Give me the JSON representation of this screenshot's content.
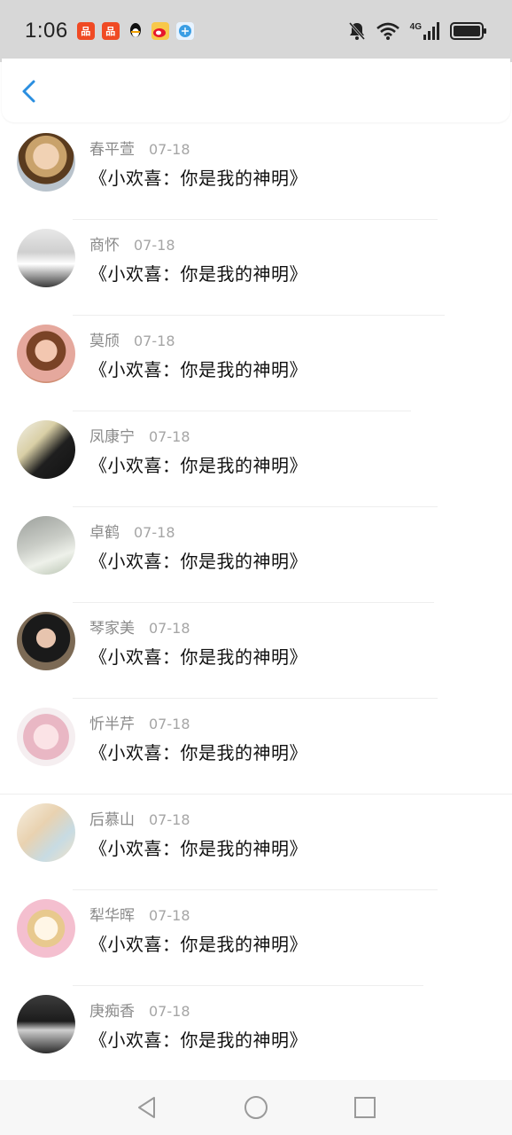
{
  "status": {
    "time": "1:06",
    "network": "4G"
  },
  "header": {
    "back_icon": "chevron-left-icon",
    "accent_color": "#2a8ee0"
  },
  "items": [
    {
      "name": "春平萱",
      "date": "07-18",
      "title": "《小欢喜：你是我的神明》"
    },
    {
      "name": "商怀",
      "date": "07-18",
      "title": "《小欢喜：你是我的神明》"
    },
    {
      "name": "莫颀",
      "date": "07-18",
      "title": "《小欢喜：你是我的神明》"
    },
    {
      "name": "凤康宁",
      "date": "07-18",
      "title": "《小欢喜：你是我的神明》"
    },
    {
      "name": "卓鹤",
      "date": "07-18",
      "title": "《小欢喜：你是我的神明》"
    },
    {
      "name": "琴家美",
      "date": "07-18",
      "title": "《小欢喜：你是我的神明》"
    },
    {
      "name": "忻半芹",
      "date": "07-18",
      "title": "《小欢喜：你是我的神明》"
    },
    {
      "name": "后慕山",
      "date": "07-18",
      "title": "《小欢喜：你是我的神明》"
    },
    {
      "name": "犁华晖",
      "date": "07-18",
      "title": "《小欢喜：你是我的神明》"
    },
    {
      "name": "庚痴香",
      "date": "07-18",
      "title": "《小欢喜：你是我的神明》"
    }
  ]
}
